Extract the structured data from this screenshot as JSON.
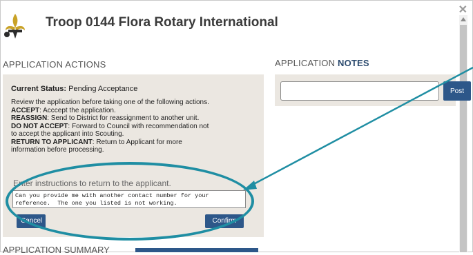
{
  "header": {
    "title": "Troop 0144 Flora Rotary International",
    "close_glyph": "✕"
  },
  "actions": {
    "heading": "APPLICATION ACTIONS",
    "status_label": "Current Status:",
    "status_value": " Pending Acceptance",
    "intro": "Review the application before taking one of the following actions.",
    "items": [
      {
        "key": "ACCEPT",
        "desc": ": Acccept the application."
      },
      {
        "key": "REASSIGN",
        "desc": ": Send to District for reassignment to another unit."
      },
      {
        "key": "DO NOT ACCEPT",
        "desc": ": Forward to Council with recommendation not"
      }
    ],
    "do_not_accept_line2": "to accept the applicant into Scouting.",
    "return_key": "RETURN TO APPLICANT",
    "return_desc": ": Return to Applicant for more",
    "return_line2": "information before processing.",
    "return_label": "Enter instructions to return to the applicant.",
    "return_text": "Can you provide me with another contact number for your reference.  The one you listed is not working.",
    "cancel_label": "Cancel",
    "confirm_label": "Confirm"
  },
  "notes": {
    "heading_plain": "APPLICATION ",
    "heading_bold": "NOTES",
    "input_value": "",
    "post_label": "Post"
  },
  "summary": {
    "heading": "APPLICATION SUMMARY"
  },
  "colors": {
    "accent": "#2d5789",
    "annotation": "#1f8ea3",
    "panel_bg": "#ebe7e1"
  }
}
